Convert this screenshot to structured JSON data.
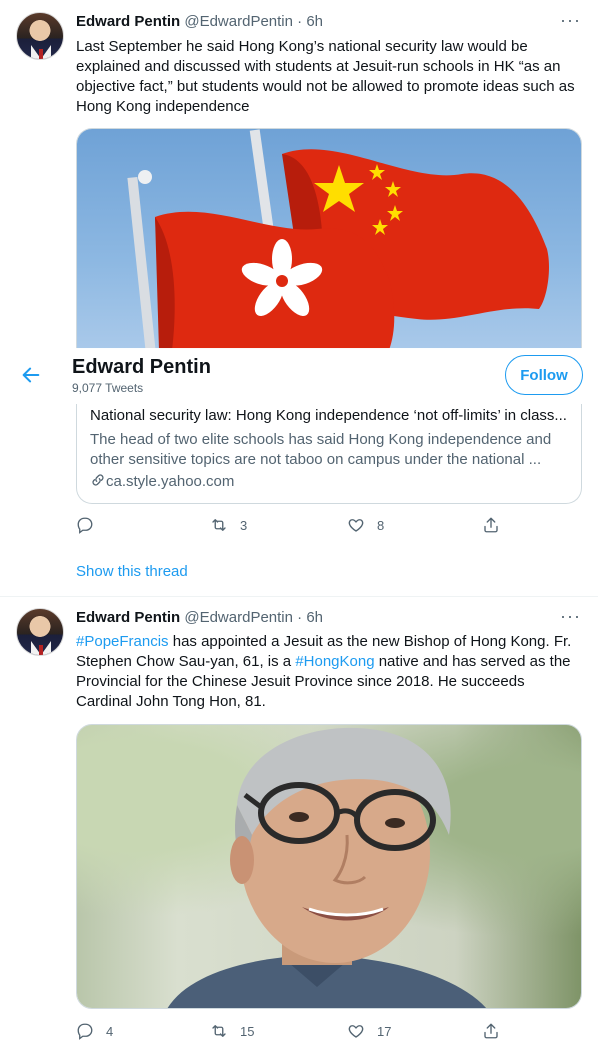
{
  "tweet1": {
    "name": "Edward Pentin",
    "handle": "@EdwardPentin",
    "time": "· 6h",
    "text": "Last September he said Hong Kong’s national security law would be explained and discussed with students at Jesuit-run schools in HK “as an objective fact,” but students would not be allowed to promote ideas such as Hong Kong independence",
    "card": {
      "title": "National security law: Hong Kong independence ‘not off-limits’ in class...",
      "description": "The head of two elite schools has said Hong Kong independence and other sensitive topics are not taboo on campus under the national ...",
      "domain": "ca.style.yahoo.com"
    },
    "reply_count": "",
    "retweet_count": "3",
    "like_count": "8",
    "show_thread": "Show this thread"
  },
  "sticky_header": {
    "name": "Edward Pentin",
    "tweet_count": "9,077 Tweets",
    "follow_label": "Follow"
  },
  "tweet2": {
    "name": "Edward Pentin",
    "handle": "@EdwardPentin",
    "time": "· 6h",
    "text_parts": {
      "tag1": "#PopeFrancis",
      "mid1": " has appointed a Jesuit as the new Bishop of Hong Kong. Fr. Stephen Chow Sau-yan, 61, is a ",
      "tag2": "#HongKong",
      "mid2": " native and has served as the Provincial for the Chinese Jesuit Province since 2018. He succeeds Cardinal John Tong Hon, 81."
    },
    "reply_count": "4",
    "retweet_count": "15",
    "like_count": "17"
  },
  "colors": {
    "accent": "#1d9bf0",
    "secondary_text": "#536471",
    "flag_red": "#de2910",
    "star_yellow": "#ffde00"
  },
  "icons": [
    "more-icon",
    "back-arrow-icon",
    "link-icon",
    "reply-icon",
    "retweet-icon",
    "like-icon",
    "share-icon"
  ]
}
